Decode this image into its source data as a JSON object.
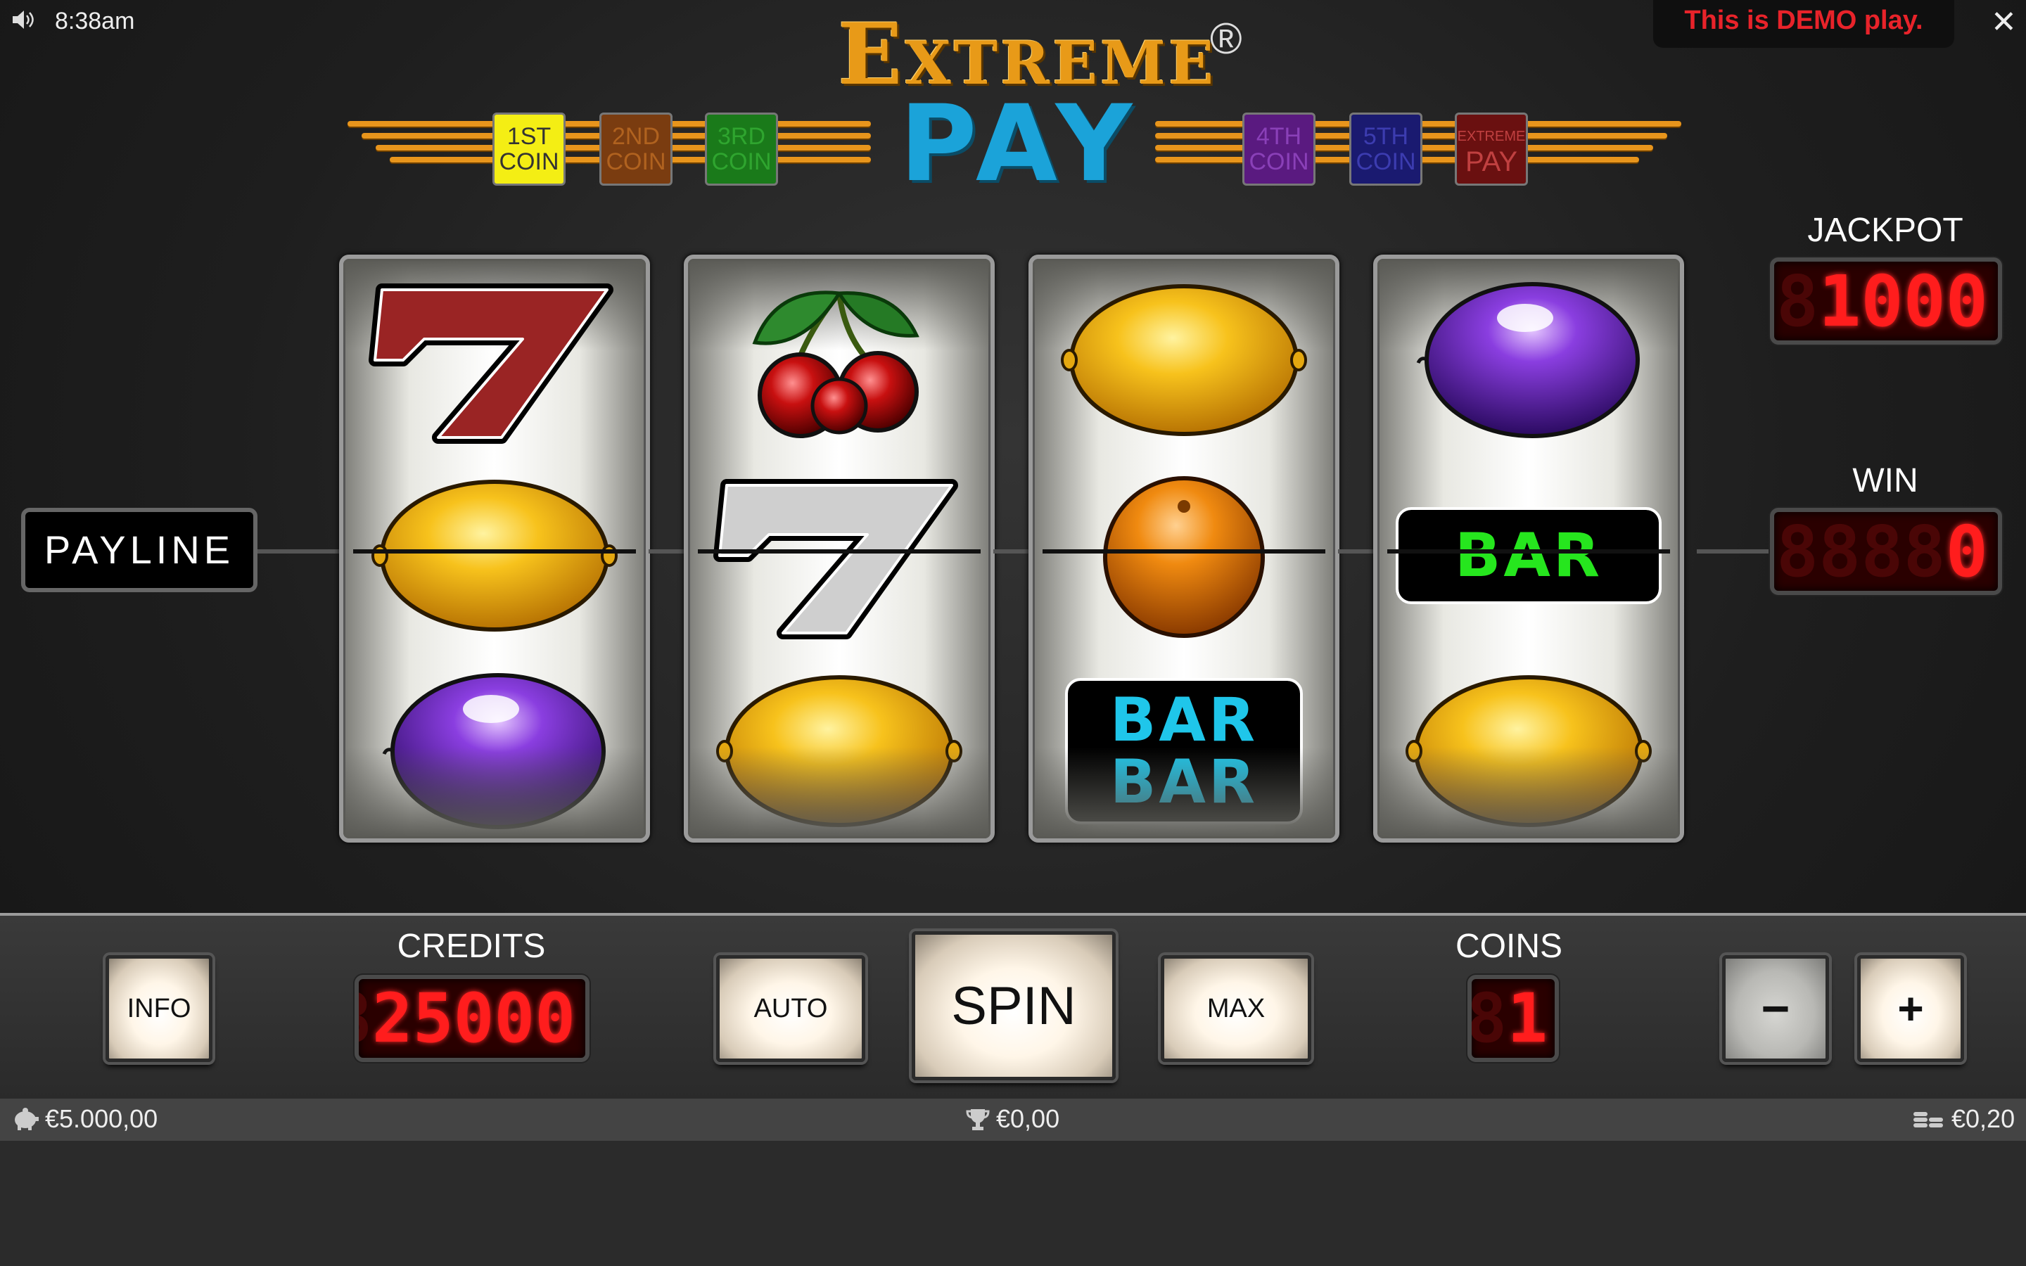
{
  "status_bar": {
    "time": "8:38am",
    "sound_icon": "speaker-icon",
    "close_icon": "close-icon"
  },
  "demo_banner": "This is DEMO play.",
  "logo": {
    "line1": "Extreme",
    "registered": "®",
    "line2": "PAY"
  },
  "coin_badges": [
    {
      "line1": "1ST",
      "line2": "COIN",
      "bg": "#f4ee14",
      "fg": "#333333"
    },
    {
      "line1": "2ND",
      "line2": "COIN",
      "bg": "#7a3c10",
      "fg": "#b0621f"
    },
    {
      "line1": "3RD",
      "line2": "COIN",
      "bg": "#1a7a1a",
      "fg": "#2fa52f"
    },
    {
      "line1": "4TH",
      "line2": "COIN",
      "bg": "#5a1a80",
      "fg": "#8a40b8"
    },
    {
      "line1": "5TH",
      "line2": "COIN",
      "bg": "#1a1a70",
      "fg": "#3c3cb0"
    },
    {
      "line1": "EXTREME",
      "line2": "PAY",
      "bg": "#6a1010",
      "fg": "#c04040"
    }
  ],
  "reels": [
    [
      "seven-red",
      "lemon",
      "plum"
    ],
    [
      "cherries",
      "seven-white",
      "lemon"
    ],
    [
      "lemon",
      "orange",
      "bar-bar"
    ],
    [
      "plum",
      "bar-green",
      "lemon"
    ]
  ],
  "symbol_text": {
    "bar": "BAR"
  },
  "payline_label": "PAYLINE",
  "jackpot": {
    "title": "JACKPOT",
    "value": "1000",
    "ghost": "888"
  },
  "win": {
    "title": "WIN",
    "value": "0",
    "ghost": "88888"
  },
  "controls": {
    "info": "INFO",
    "credits_title": "CREDITS",
    "credits_value": "25000",
    "credits_ghost": "8",
    "auto": "AUTO",
    "spin": "SPIN",
    "max": "MAX",
    "coins_title": "COINS",
    "coins_value": "1",
    "coins_ghost": "8",
    "minus": "−",
    "plus": "+"
  },
  "footer": {
    "balance": "€5.000,00",
    "balance_icon": "piggy-bank-icon",
    "win": "€0,00",
    "win_icon": "trophy-icon",
    "bet": "€0,20",
    "bet_icon": "coin-stack-icon"
  },
  "colors": {
    "demo_text": "#e8232a",
    "led_red": "#ff1d1d",
    "logo_orange": "#e89a18",
    "logo_blue": "#1ba3d9"
  }
}
